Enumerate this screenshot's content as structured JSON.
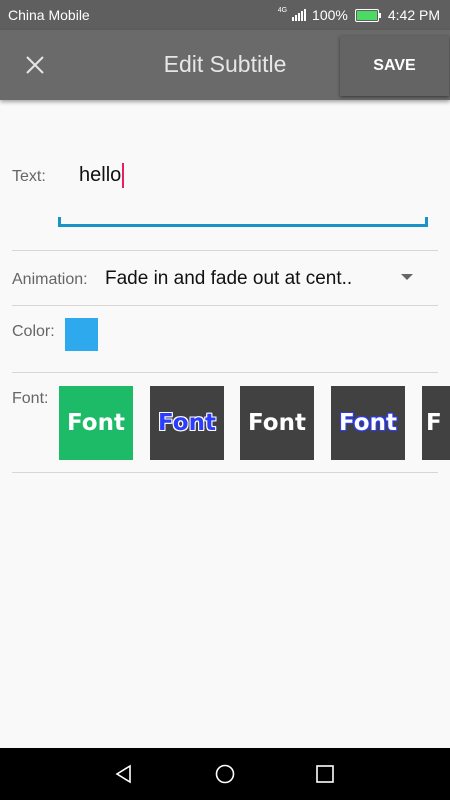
{
  "status_bar": {
    "carrier": "China Mobile",
    "network": "4G",
    "battery": "100%",
    "time": "4:42 PM"
  },
  "toolbar": {
    "title": "Edit Subtitle",
    "save_label": "SAVE"
  },
  "text_field": {
    "label": "Text:",
    "value": "hello"
  },
  "animation": {
    "label": "Animation:",
    "selected": "Fade in and fade out at cent.."
  },
  "color": {
    "label": "Color:",
    "swatch": "#2fa9ee"
  },
  "font": {
    "label": "Font:",
    "options": [
      {
        "text": "Font",
        "style": "white on green",
        "bg": "#1dba68",
        "fg": "#ffffff",
        "outline": "none"
      },
      {
        "text": "Font",
        "style": "blue with white outline",
        "bg": "#414141",
        "fg": "#2c3cff",
        "outline": "#ffffff"
      },
      {
        "text": "Font",
        "style": "white on dark",
        "bg": "#414141",
        "fg": "#ffffff",
        "outline": "none"
      },
      {
        "text": "Font",
        "style": "white with blue outline",
        "bg": "#414141",
        "fg": "#ffffff",
        "outline": "#2c3cff"
      },
      {
        "text": "F",
        "style": "partially visible",
        "bg": "#414141",
        "fg": "#ffffff",
        "outline": "none"
      }
    ]
  },
  "icons": {
    "close": "close-icon",
    "dropdown": "dropdown-arrow-icon",
    "back": "back-icon",
    "home": "home-icon",
    "recents": "recents-icon"
  }
}
